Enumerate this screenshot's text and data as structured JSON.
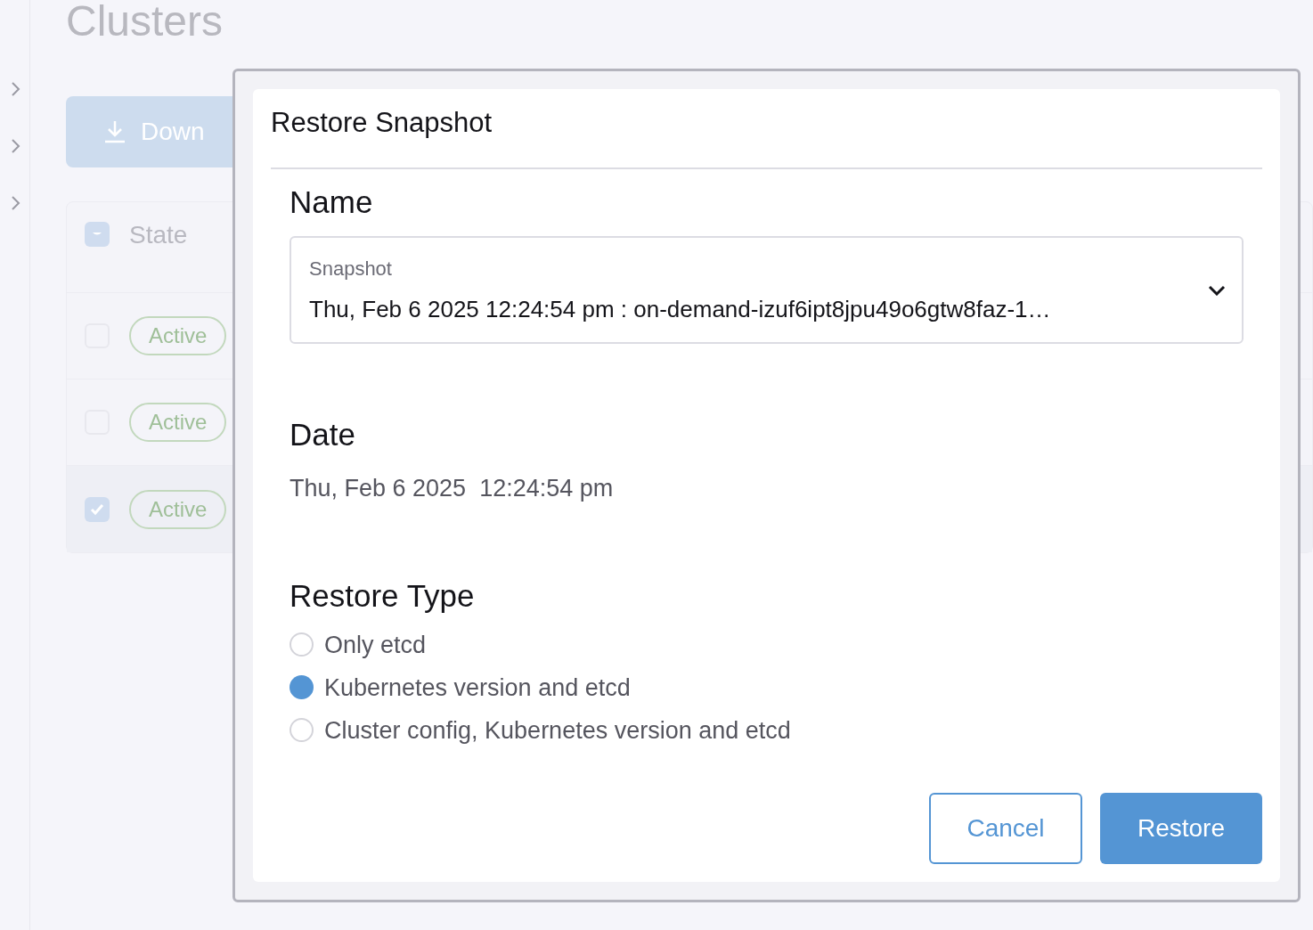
{
  "sidebar": {
    "items": [
      {
        "expanded": false
      },
      {
        "expanded": false
      },
      {
        "expanded": false
      }
    ]
  },
  "page": {
    "title": "Clusters",
    "download_button": "Down"
  },
  "table": {
    "header": {
      "indeterminate": true,
      "column_1": "State"
    },
    "rows": [
      {
        "selected": false,
        "state": "Active"
      },
      {
        "selected": false,
        "state": "Active"
      },
      {
        "selected": true,
        "state": "Active"
      }
    ]
  },
  "dialog": {
    "title": "Restore Snapshot",
    "name_heading": "Name",
    "snapshot": {
      "label": "Snapshot",
      "value": "Thu, Feb 6 2025 12:24:54 pm : on-demand-izuf6ipt8jpu49o6gtw8faz-1…"
    },
    "date_heading": "Date",
    "date": "Thu, Feb 6 2025  12:24:54 pm",
    "restore_type_heading": "Restore Type",
    "options": [
      {
        "label": "Only etcd",
        "selected": false
      },
      {
        "label": "Kubernetes version and etcd",
        "selected": true
      },
      {
        "label": "Cluster config, Kubernetes version and etcd",
        "selected": false
      }
    ],
    "buttons": [
      {
        "kind": "secondary",
        "label": "Cancel"
      },
      {
        "kind": "primary",
        "label": "Restore"
      }
    ]
  }
}
